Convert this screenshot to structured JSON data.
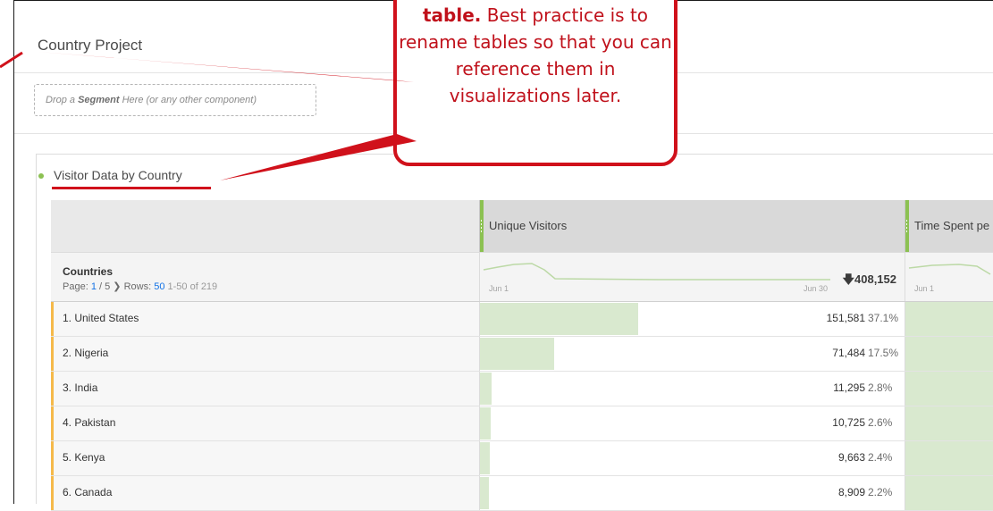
{
  "project": {
    "title": "Country Project",
    "dropzone": {
      "prefix": "Drop a ",
      "bold": "Segment",
      "suffix": " Here (or any other component)"
    }
  },
  "panel": {
    "title": "Visitor Data by Country"
  },
  "table": {
    "metric_headers": [
      "Unique Visitors",
      "Time Spent pe"
    ],
    "dimension": "Countries",
    "pager": {
      "page_label": "Page: ",
      "page": "1",
      "of": " / 5",
      "rows_label": " Rows: ",
      "rows": "50",
      "range": "1-50 of 219"
    },
    "trend": {
      "start": "Jun 1",
      "end": "Jun 30",
      "start2": "Jun 1"
    },
    "total": "408,152",
    "rows": [
      {
        "label": "1.  United States",
        "value": "151,581",
        "pct": "37.1%",
        "share": 37.1
      },
      {
        "label": "2.  Nigeria",
        "value": "71,484",
        "pct": "17.5%",
        "share": 17.5
      },
      {
        "label": "3.  India",
        "value": "11,295",
        "pct": "2.8%",
        "share": 2.8
      },
      {
        "label": "4.  Pakistan",
        "value": "10,725",
        "pct": "2.6%",
        "share": 2.6
      },
      {
        "label": "5.  Kenya",
        "value": "9,663",
        "pct": "2.4%",
        "share": 2.4
      },
      {
        "label": "6.  Canada",
        "value": "8,909",
        "pct": "2.2%",
        "share": 2.2
      }
    ]
  },
  "callout": {
    "bold": "table.",
    "text": " Best practice is to rename tables so that you can reference them in visualizations later."
  },
  "colors": {
    "accent": "#d0111b",
    "bar": "#d9e9cf",
    "handle": "#8cc152",
    "row_marker": "#f5b94a",
    "link": "#1473e6"
  }
}
